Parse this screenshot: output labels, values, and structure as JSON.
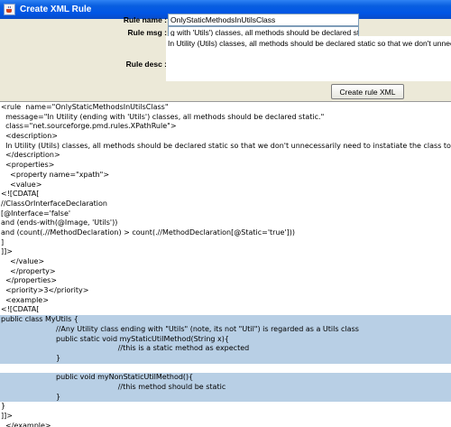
{
  "window": {
    "title": "Create XML Rule",
    "icon": "java-cup-icon"
  },
  "form": {
    "rule_name_label": "Rule name :",
    "rule_name_value": "OnlyStaticMethodsInUtilsClass",
    "rule_msg_label": "Rule msg :",
    "rule_msg_value": "Utility (ending with 'Utils') classes, all methods should be declared static.",
    "rule_msg_visible": "g with 'Utils') classes, all methods should be declared static.",
    "rule_desc_label": "Rule desc :",
    "rule_desc_value": "In Utility (Utils) classes, all methods should be declared static so that we don't unnecessarily need to instatiate the class to use the methods.",
    "create_button_label": "Create rule XML"
  },
  "xml_output": {
    "lines": [
      {
        "text": "<rule  name=\"OnlyStaticMethodsInUtilsClass\"",
        "selected": false
      },
      {
        "text": "  message=\"In Utility (ending with 'Utils') classes, all methods should be declared static.\"",
        "selected": false
      },
      {
        "text": "  class=\"net.sourceforge.pmd.rules.XPathRule\">",
        "selected": false
      },
      {
        "text": "  <description>",
        "selected": false
      },
      {
        "text": "  In Utility (Utils) classes, all methods should be declared static so that we don't unnecessarily need to instatiate the class to use the methods.",
        "selected": false
      },
      {
        "text": "  </description>",
        "selected": false
      },
      {
        "text": "  <properties>",
        "selected": false
      },
      {
        "text": "    <property name=\"xpath\">",
        "selected": false
      },
      {
        "text": "    <value>",
        "selected": false
      },
      {
        "text": "<![CDATA[",
        "selected": false
      },
      {
        "text": "//ClassOrInterfaceDeclaration",
        "selected": false
      },
      {
        "text": "[@Interface='false'",
        "selected": false
      },
      {
        "text": "and (ends-with(@Image, 'Utils'))",
        "selected": false
      },
      {
        "text": "and (count(.//MethodDeclaration) > count(.//MethodDeclaration[@Static='true']))",
        "selected": false
      },
      {
        "text": "]",
        "selected": false
      },
      {
        "text": "]]>",
        "selected": false
      },
      {
        "text": "    </value>",
        "selected": false
      },
      {
        "text": "    </property>",
        "selected": false
      },
      {
        "text": "  </properties>",
        "selected": false
      },
      {
        "text": "  <priority>3</priority>",
        "selected": false
      },
      {
        "text": "  <example>",
        "selected": false
      },
      {
        "text": "<![CDATA[",
        "selected": false
      },
      {
        "text": "public class MyUtils {",
        "selected": true
      },
      {
        "text": "                        //Any Utility class ending with \"Utils\" (note, its not \"Util\") is regarded as a Utils class",
        "selected": true
      },
      {
        "text": "                        public static void myStaticUtilMethod(String x){",
        "selected": true
      },
      {
        "text": "                                                   //this is a static method as expected",
        "selected": true
      },
      {
        "text": "                        }",
        "selected": true
      },
      {
        "text": "",
        "selected": false
      },
      {
        "text": "                        public void myNonStaticUtilMethod(){",
        "selected": true
      },
      {
        "text": "                                                   //this method should be static",
        "selected": true
      },
      {
        "text": "                        }",
        "selected": true
      },
      {
        "text": "}",
        "selected": false
      },
      {
        "text": "]]>",
        "selected": false
      },
      {
        "text": "  </example>",
        "selected": false
      },
      {
        "text": "</rule>",
        "selected": false
      }
    ]
  },
  "colors": {
    "titlebar": "#0055e5",
    "selection": "#b8cfe5",
    "background": "#ece9d8"
  }
}
